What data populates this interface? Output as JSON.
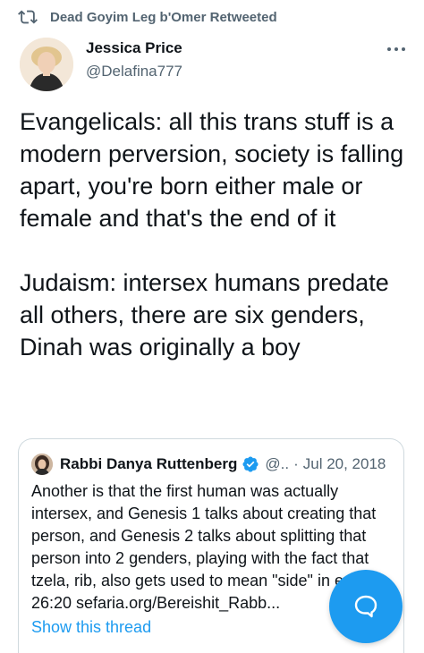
{
  "retweet": {
    "text": "Dead Goyim Leg b'Omer Retweeted"
  },
  "tweet": {
    "author_name": "Jessica Price",
    "author_handle": "@Delafina777",
    "paragraphs": [
      "Evangelicals: all this trans stuff is a modern perversion, society is falling apart, you're born either male or female and that's the end of it",
      "Judaism: intersex humans predate all others, there are six genders, Dinah was originally a boy"
    ]
  },
  "quote": {
    "author_name": "Rabbi Danya Ruttenberg",
    "author_handle": "@..",
    "separator": "·",
    "date": "Jul 20, 2018",
    "text": "Another is that the first human was actually intersex, and Genesis 1 talks about creating that person, and Genesis 2 talks about splitting that person into 2 genders, playing with the fact that tzela, rib, also gets used to mean \"side\" in ex. 26:20 sefaria.org/Bereishit_Rabb...",
    "show_thread": "Show this thread"
  },
  "icons": {
    "retweet": "retweet-icon",
    "more": "more-icon",
    "verified": "verified-icon",
    "compose": "compose-reply-icon"
  },
  "colors": {
    "accent": "#1d9bf0",
    "secondary_text": "#536471",
    "primary_text": "#0f1419",
    "border": "#cfd9de"
  }
}
